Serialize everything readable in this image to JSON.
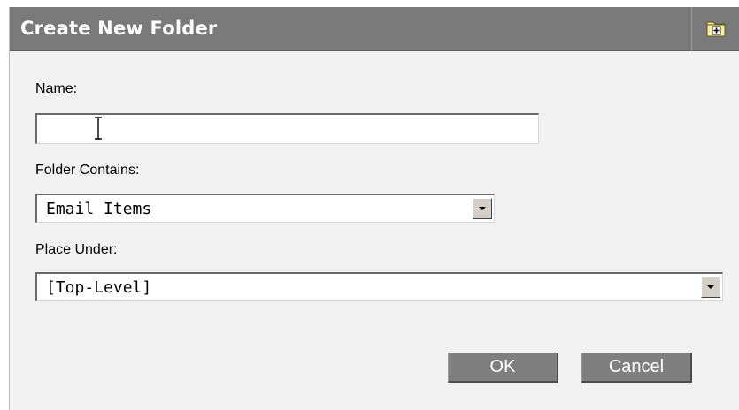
{
  "dialog": {
    "title": "Create New Folder",
    "title_icon": "new-folder-icon"
  },
  "fields": {
    "name_label": "Name:",
    "name_value": "",
    "contains_label": "Folder Contains:",
    "contains_value": "Email Items",
    "place_label": "Place Under:",
    "place_value": "[Top-Level]"
  },
  "buttons": {
    "ok_label": "OK",
    "cancel_label": "Cancel"
  },
  "colors": {
    "titlebar": "#7a7a7a",
    "dialog_background": "#f1f1f1",
    "button": "#7f7f7f"
  }
}
